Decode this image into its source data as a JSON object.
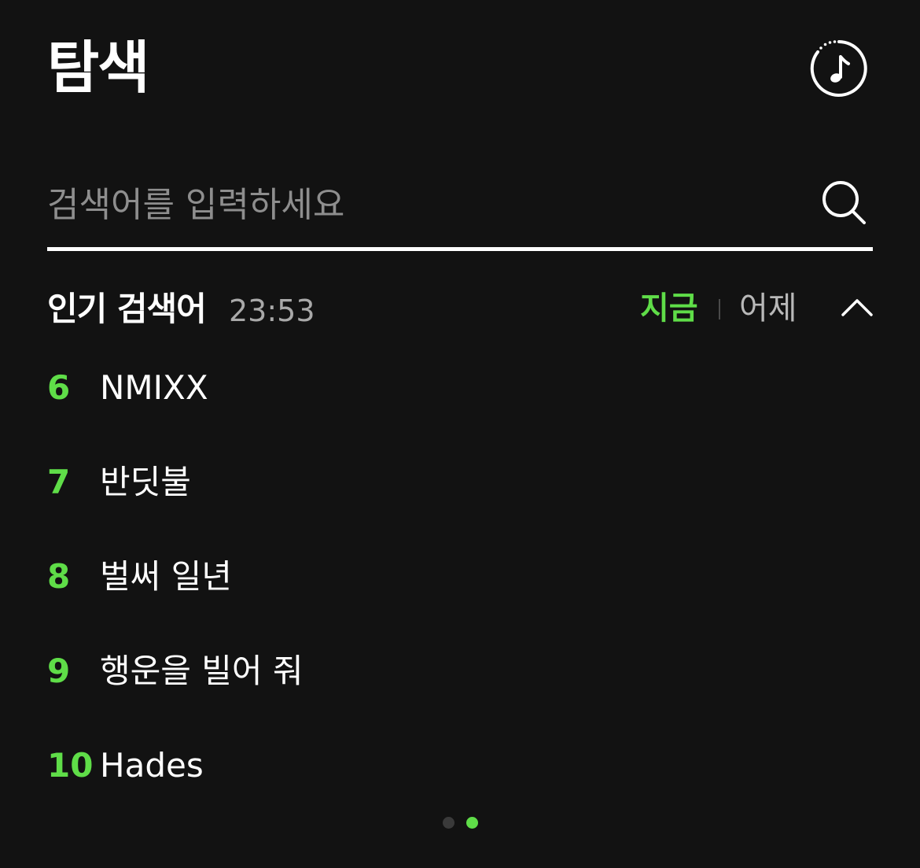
{
  "header": {
    "title": "탐색"
  },
  "search": {
    "placeholder": "검색어를 입력하세요"
  },
  "popular": {
    "title": "인기 검색어",
    "time": "23:53",
    "tabs": {
      "now": "지금",
      "yesterday": "어제"
    },
    "active_tab": "지금",
    "items": [
      {
        "rank": "6",
        "term": "NMIXX"
      },
      {
        "rank": "7",
        "term": "반딧불"
      },
      {
        "rank": "8",
        "term": "벌써 일년"
      },
      {
        "rank": "9",
        "term": "행운을 빌어 줘"
      },
      {
        "rank": "10",
        "term": "Hades"
      }
    ]
  },
  "pager": {
    "total_pages": 2,
    "active_page": 2
  },
  "colors": {
    "background": "#121212",
    "accent": "#5fdd48",
    "text": "#ffffff",
    "muted": "#a9a9a9",
    "dot_inactive": "#3a3a3a"
  },
  "icons": {
    "music_history": "music-note-icon",
    "search": "search-icon",
    "collapse": "chevron-up-icon"
  }
}
